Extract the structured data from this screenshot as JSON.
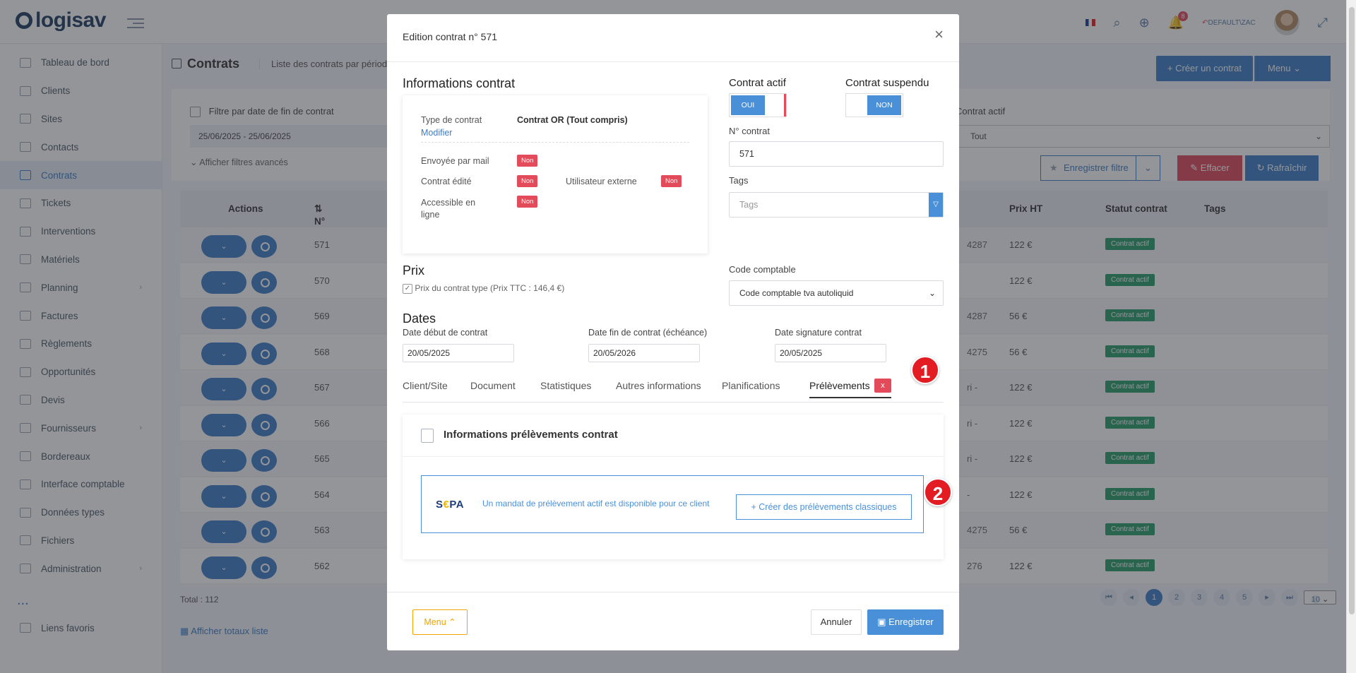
{
  "topbar": {
    "logo": "logisav",
    "notif_count": "8",
    "user": "DEFAULT\\ZAC"
  },
  "sidebar": {
    "items": [
      {
        "label": "Tableau de bord"
      },
      {
        "label": "Clients"
      },
      {
        "label": "Sites"
      },
      {
        "label": "Contacts"
      },
      {
        "label": "Contrats",
        "active": true
      },
      {
        "label": "Tickets"
      },
      {
        "label": "Interventions"
      },
      {
        "label": "Matériels"
      },
      {
        "label": "Planning",
        "chevron": true
      },
      {
        "label": "Factures"
      },
      {
        "label": "Règlements"
      },
      {
        "label": "Opportunités"
      },
      {
        "label": "Devis"
      },
      {
        "label": "Fournisseurs",
        "chevron": true
      },
      {
        "label": "Bordereaux"
      },
      {
        "label": "Interface comptable"
      },
      {
        "label": "Données types"
      },
      {
        "label": "Fichiers"
      },
      {
        "label": "Administration",
        "chevron": true
      }
    ],
    "dots": "...",
    "favoris": "Liens favoris"
  },
  "page": {
    "title": "Contrats",
    "subtitle": "Liste des contrats par période",
    "create": "+ Créer un contrat",
    "menu": "Menu"
  },
  "filters": {
    "date_filter": "Filtre par date de fin de contrat",
    "date_range": "25/06/2025 - 25/06/2025",
    "advanced": "Afficher filtres avancés",
    "actif_label": "Contrat actif",
    "actif_value": "Tout",
    "save_filter": "Enregistrer filtre",
    "clear": "Effacer",
    "refresh": "Rafraîchir"
  },
  "table": {
    "headers": {
      "actions": "Actions",
      "num": "N° contrat",
      "prix": "Prix HT",
      "statut": "Statut contrat",
      "tags": "Tags"
    },
    "rows": [
      {
        "num": "571",
        "ref": "4287",
        "ht": "122 €",
        "st": "Contrat actif"
      },
      {
        "num": "570",
        "ref": "",
        "ht": "122 €",
        "st": "Contrat actif"
      },
      {
        "num": "569",
        "ref": "4287",
        "ht": "56 €",
        "st": "Contrat actif"
      },
      {
        "num": "568",
        "ref": "4275",
        "ht": "56 €",
        "st": "Contrat actif"
      },
      {
        "num": "567",
        "ref": "ri -",
        "ht": "122 €",
        "st": "Contrat actif"
      },
      {
        "num": "566",
        "ref": "ri -",
        "ht": "122 €",
        "st": "Contrat actif"
      },
      {
        "num": "565",
        "ref": "ri -",
        "ht": "122 €",
        "st": "Contrat actif"
      },
      {
        "num": "564",
        "ref": "-",
        "ht": "122 €",
        "st": "Contrat actif"
      },
      {
        "num": "563",
        "ref": "4275",
        "ht": "56 €",
        "st": "Contrat actif"
      },
      {
        "num": "562",
        "ref": "276",
        "ht": "122 €",
        "st": "Contrat actif"
      }
    ],
    "total": "Total : 112",
    "totaux_link": "Afficher totaux liste",
    "pages": [
      "1",
      "2",
      "3",
      "4",
      "5"
    ],
    "page_size": "10"
  },
  "modal": {
    "title": "Edition contrat n° 571",
    "info_title": "Informations contrat",
    "type_label": "Type de contrat",
    "type_value": "Contrat OR (Tout compris)",
    "modify": "Modifier",
    "sent_label": "Envoyée par mail",
    "edited_label": "Contrat édité",
    "external_label": "Utilisateur externe",
    "online_label": "Accessible en ligne",
    "non": "Non",
    "actif_title": "Contrat actif",
    "actif_value": "OUI",
    "suspendu_title": "Contrat suspendu",
    "suspendu_value": "NON",
    "num_label": "N° contrat",
    "num_value": "571",
    "tags_label": "Tags",
    "tags_placeholder": "Tags",
    "prix_title": "Prix",
    "prix_check": "Prix du contrat type (Prix TTC : 146,4 €)",
    "code_label": "Code comptable",
    "code_value": "Code comptable tva autoliquid",
    "dates_title": "Dates",
    "debut_label": "Date début de contrat",
    "debut_value": "20/05/2025",
    "fin_label": "Date fin de contrat (échéance)",
    "fin_value": "20/05/2026",
    "sign_label": "Date signature contrat",
    "sign_value": "20/05/2025",
    "tabs": [
      "Client/Site",
      "Document",
      "Statistiques",
      "Autres informations",
      "Planifications",
      "Prélèvements"
    ],
    "tab_badge": "x",
    "prel_title": "Informations prélèvements contrat",
    "sepa_logo_s": "S",
    "sepa_logo_e": "€",
    "sepa_logo_pa": "PA",
    "sepa_msg": "Un mandat de prélèvement actif est disponible pour ce client",
    "sepa_btn": "+ Créer des prélèvements classiques",
    "foot_menu": "Menu",
    "cancel": "Annuler",
    "save": "Enregistrer"
  },
  "callouts": [
    "1",
    "2"
  ],
  "colors": {
    "accent": "#4a90d9",
    "danger": "#e34b5b",
    "success": "#2a9d6a",
    "callout": "#e31b23"
  }
}
